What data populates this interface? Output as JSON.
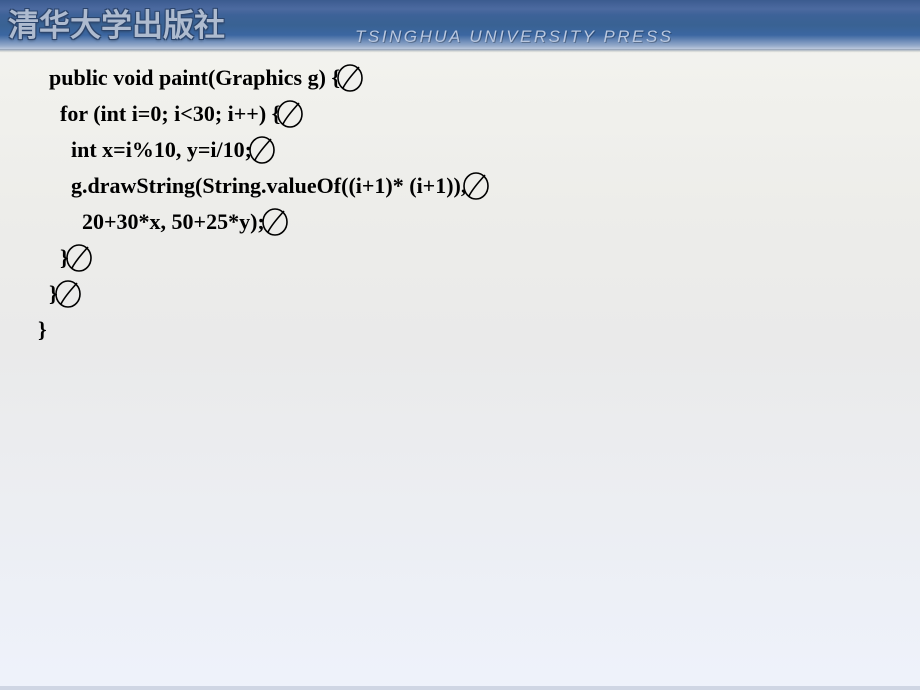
{
  "header": {
    "logo_cn": "清华大学出版社",
    "logo_en": "TSINGHUA UNIVERSITY PRESS"
  },
  "code": {
    "lines": [
      {
        "indent": 0,
        "text": "public void paint(Graphics g) {",
        "annot": true
      },
      {
        "indent": 1,
        "text": "for (int i=0; i<30; i++) {",
        "annot": true
      },
      {
        "indent": 2,
        "text": "int x=i%10, y=i/10;",
        "annot": true
      },
      {
        "indent": 2,
        "text": "g.drawString(String.valueOf((i+1)* (i+1)),",
        "annot": true
      },
      {
        "indent": 3,
        "text": "20+30*x, 50+25*y);",
        "annot": true
      },
      {
        "indent": 1,
        "text": "}",
        "annot": true
      },
      {
        "indent": 0,
        "text": "}",
        "annot": true
      },
      {
        "indent": -1,
        "text": "}",
        "annot": false
      }
    ]
  }
}
